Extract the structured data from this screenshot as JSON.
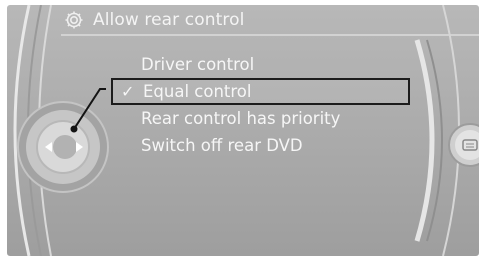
{
  "header": {
    "title": "Allow rear control",
    "icon": "settings-gear-icon"
  },
  "menu": {
    "items": [
      {
        "label": "Driver control",
        "selected": false
      },
      {
        "label": "Equal control",
        "selected": true
      },
      {
        "label": "Rear control has priority",
        "selected": false
      },
      {
        "label": "Switch off rear DVD",
        "selected": false
      }
    ],
    "selected_mark": "✓"
  },
  "controller": {
    "left_arrow": "◀",
    "right_arrow": "▶"
  },
  "colors": {
    "background": "#aaaaaa",
    "text": "#f6f6f6",
    "selection_border": "#1c1c1c"
  }
}
